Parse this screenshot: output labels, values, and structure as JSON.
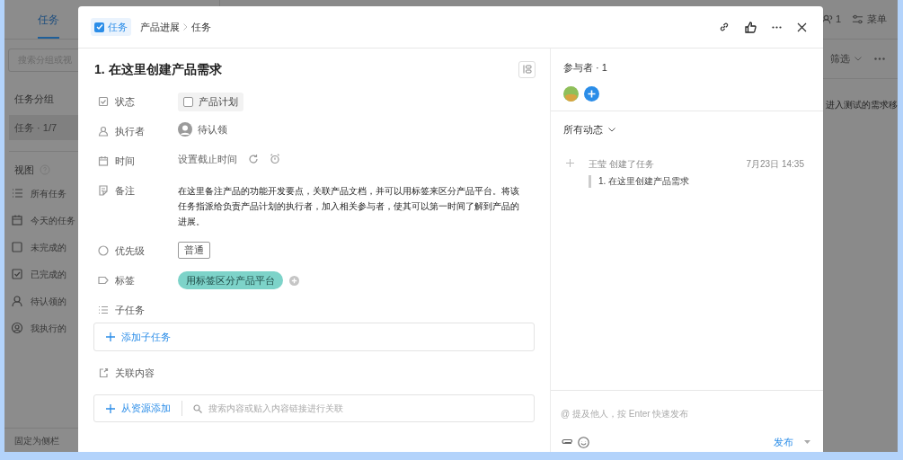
{
  "background_app": {
    "tabs": [
      {
        "label": "任务",
        "selected": true
      }
    ],
    "search": {
      "placeholder": "搜索分组或视"
    },
    "group_heading": "任务分组",
    "groups": [
      {
        "label": "任务 · 1/7",
        "selected": true
      }
    ],
    "views_heading": "视图",
    "views": [
      {
        "kind": "list",
        "label": "所有任务"
      },
      {
        "kind": "calendar",
        "label": "今天的任务"
      },
      {
        "kind": "box",
        "label": "未完成的"
      },
      {
        "kind": "checked",
        "label": "已完成的"
      },
      {
        "kind": "person",
        "label": "待认领的"
      },
      {
        "kind": "user",
        "label": "我执行的"
      }
    ],
    "pin": "固定为侧栏",
    "member_count": "1",
    "menu": "菜单",
    "filter": "筛选",
    "row_text": "进入测试的需求移"
  },
  "dialog": {
    "type_badge": {
      "label": "任务",
      "checked": true
    },
    "breadcrumb": [
      "产品进展",
      "任务"
    ],
    "title": "1. 在这里创建产品需求",
    "fields": [
      {
        "kind": "status",
        "label": "状态",
        "value": "产品计划",
        "checked": false
      },
      {
        "kind": "assignee",
        "label": "执行者",
        "value": "待认领"
      },
      {
        "kind": "time",
        "label": "时间",
        "value": "设置截止时间"
      },
      {
        "kind": "note",
        "label": "备注",
        "value": "在这里备注产品的功能开发要点，关联产品文档，并可以用标签来区分产品平台。将该任务指派给负责产品计划的执行者，加入相关参与者，使其可以第一时间了解到产品的进展。"
      },
      {
        "kind": "priority",
        "label": "优先级",
        "value": "普通"
      },
      {
        "kind": "tags",
        "label": "标签",
        "tags": [
          {
            "label": "用标签区分产品平台",
            "color": "#7dd3c9"
          }
        ]
      },
      {
        "kind": "subtasks",
        "label": "子任务",
        "action": "添加子任务"
      }
    ],
    "related": {
      "label": "关联内容",
      "action": "从资源添加",
      "search_placeholder": "搜索内容或贴入内容链接进行关联"
    },
    "participants": {
      "heading": "参与者 · 1"
    },
    "activity_filter": "所有动态",
    "activity": [
      {
        "actor": "王莹 创建了任务",
        "time": "7月23日 14:35",
        "quote": "1. 在这里创建产品需求"
      }
    ],
    "comment": {
      "placeholder": "@ 提及他人，按 Enter 快速发布",
      "publish": "发布"
    }
  }
}
